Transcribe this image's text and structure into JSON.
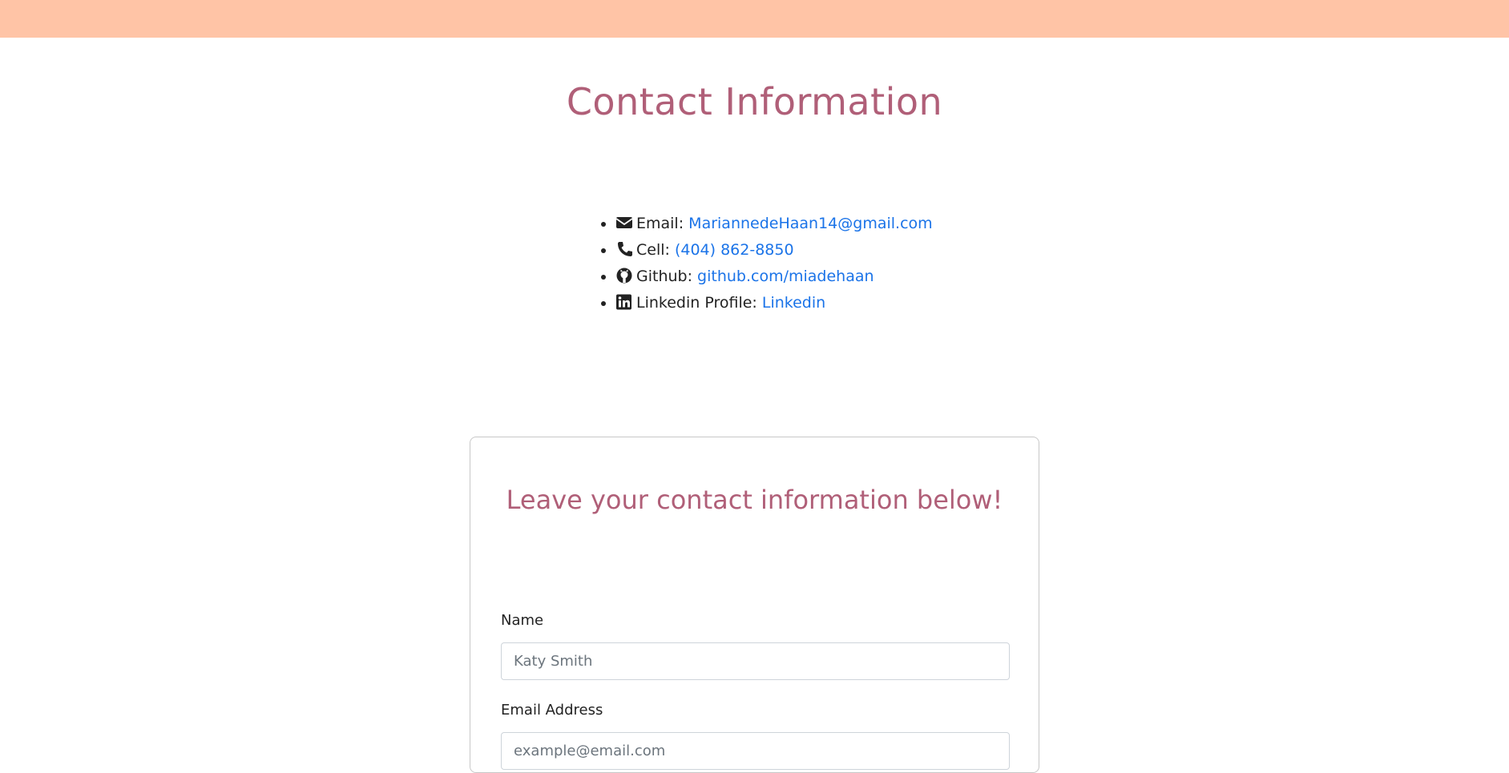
{
  "page": {
    "title": "Contact Information"
  },
  "contacts": [
    {
      "icon": "envelope-icon",
      "label": "Email:",
      "value": "MariannedeHaan14@gmail.com"
    },
    {
      "icon": "phone-icon",
      "label": "Cell:",
      "value": "(404) 862-8850"
    },
    {
      "icon": "github-icon",
      "label": "Github:",
      "value": "github.com/miadehaan"
    },
    {
      "icon": "linkedin-icon",
      "label": "Linkedin Profile:",
      "value": "Linkedin"
    }
  ],
  "form": {
    "title": "Leave your contact information below!",
    "name_label": "Name",
    "name_placeholder": "Katy Smith",
    "email_label": "Email Address",
    "email_placeholder": "example@email.com"
  },
  "colors": {
    "topbar": "#ffc4a6",
    "heading": "#b05f78",
    "link": "#1a73e8"
  }
}
